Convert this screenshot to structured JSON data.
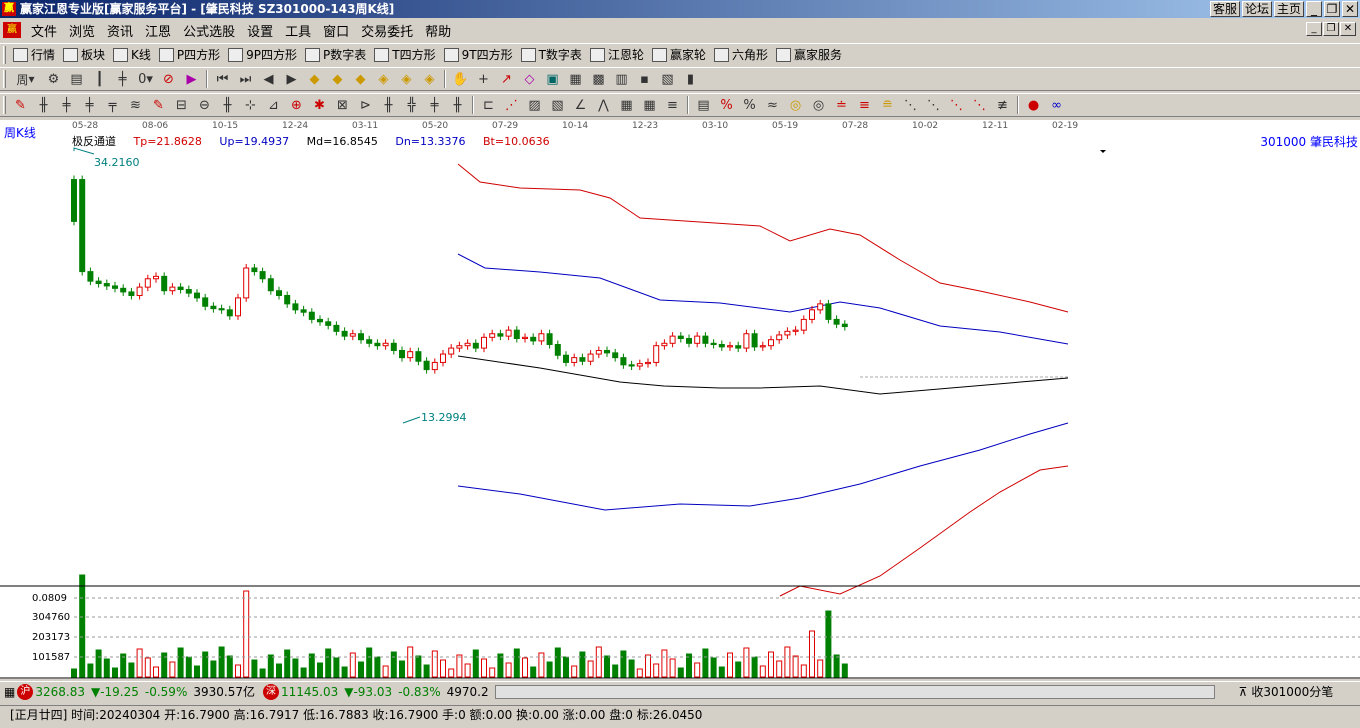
{
  "window": {
    "title": "赢家江恩专业版[赢家服务平台] - [肇民科技   SZ301000-143周K线]",
    "app_icon": "app-logo-icon",
    "btn_service": "客服",
    "btn_forum": "论坛",
    "btn_home": "主页"
  },
  "menu": [
    "文件",
    "浏览",
    "资讯",
    "江恩",
    "公式选股",
    "设置",
    "工具",
    "窗口",
    "交易委托",
    "帮助"
  ],
  "toolbar1": [
    {
      "label": "行情",
      "icon": "grid-icon"
    },
    {
      "label": "板块",
      "icon": "blocks-icon"
    },
    {
      "label": "K线",
      "icon": "candle-icon"
    },
    {
      "label": "P四方形",
      "icon": "ps-icon"
    },
    {
      "label": "9P四方形",
      "icon": "p9-icon"
    },
    {
      "label": "P数字表",
      "icon": "pn-icon"
    },
    {
      "label": "T四方形",
      "icon": "ts-icon"
    },
    {
      "label": "9T四方形",
      "icon": "t9-icon"
    },
    {
      "label": "T数字表",
      "icon": "tn-icon"
    },
    {
      "label": "江恩轮",
      "icon": "wheel-icon"
    },
    {
      "label": "赢家轮",
      "icon": "wheel2-icon"
    },
    {
      "label": "六角形",
      "icon": "hexagon-icon"
    },
    {
      "label": "赢家服务",
      "icon": "dollar-icon"
    }
  ],
  "toolbar2": {
    "period": "周"
  },
  "chart": {
    "period_label": "周K线",
    "date_ticks": [
      "05-28",
      "08-06",
      "10-15",
      "12-24",
      "03-11",
      "05-20",
      "07-29",
      "10-14",
      "12-23",
      "03-10",
      "05-19",
      "07-28",
      "10-02",
      "12-11",
      "02-19"
    ],
    "indicator": {
      "name": "极反通道",
      "tp": "Tp=21.8628",
      "up": "Up=19.4937",
      "md": "Md=16.8545",
      "dn": "Dn=13.3376",
      "bt": "Bt=10.0636"
    },
    "stock": "301000  肇民科技",
    "high_label": "34.2160",
    "low_label": "13.2994",
    "vol_axis": [
      "0.0809",
      "304760",
      "203173",
      "101587"
    ],
    "colors": {
      "up": "#e00000",
      "down": "#008000",
      "blue": "#0000c0",
      "red": "#d00000"
    }
  },
  "chart_data": {
    "type": "candlestick",
    "title": "",
    "max_price": 34.216,
    "min_price": 13.2994,
    "indicator_values": {
      "Tp": 21.8628,
      "Up": 19.4937,
      "Md": 16.8545,
      "Dn": 13.3376,
      "Bt": 10.0636
    },
    "volume_ticks": [
      101587,
      203173,
      304760
    ]
  },
  "status": {
    "sh_icon": "沪",
    "sh_value": "3268.83",
    "sh_change": "▼-19.25",
    "sh_pct": "-0.59%",
    "sh_amount": "3930.57亿",
    "sz_icon": "深",
    "sz_value": "11145.03",
    "sz_change": "▼-93.03",
    "sz_pct": "-0.83%",
    "sz_amount": "4970.2",
    "right_text": "收301000分笔"
  },
  "info": "[正月廿四] 时间:20240304 开:16.7900 高:16.7917 低:16.7883 收:16.7900 手:0 额:0.00 换:0.00 涨:0.00 盘:0 标:26.0450"
}
